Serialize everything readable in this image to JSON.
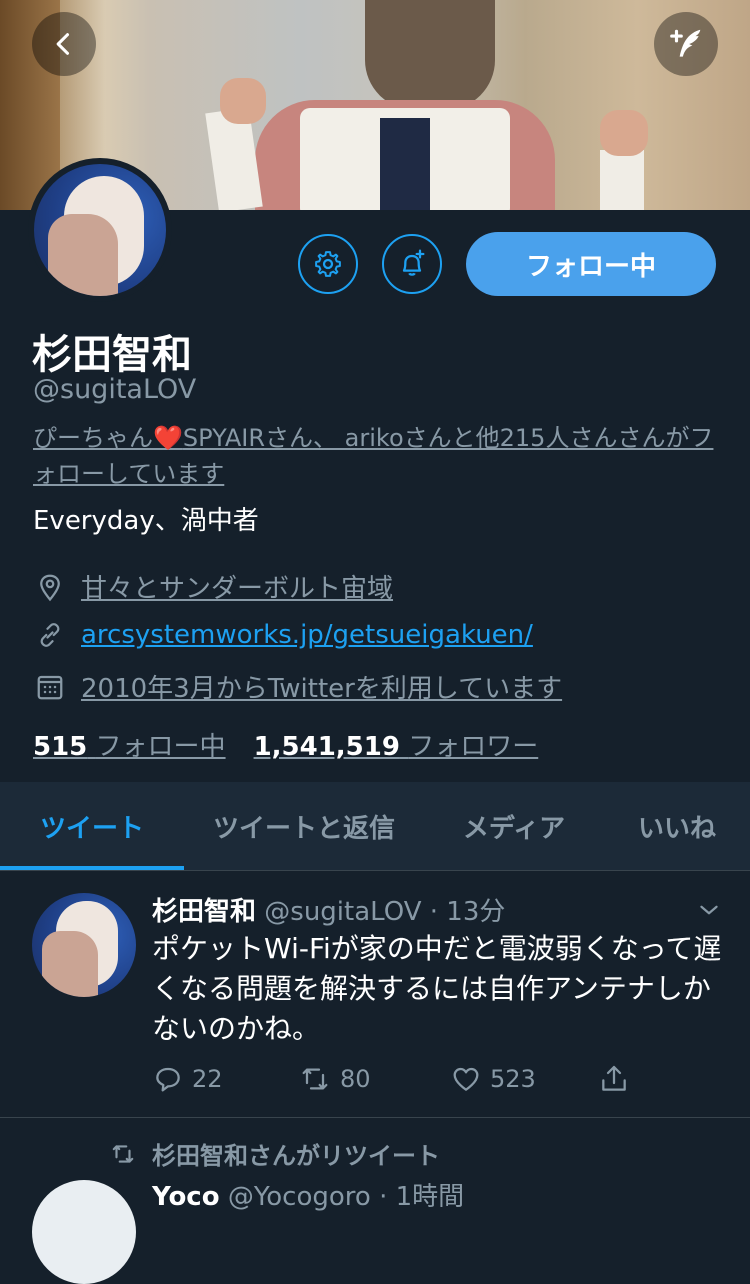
{
  "header": {
    "back_icon": "chevron-left-icon",
    "compose_icon": "compose-tweet-icon"
  },
  "profile": {
    "name": "杉田智和",
    "handle": "@sugitaLOV",
    "followed_by_prefix": "ぴーちゃん",
    "followed_by_rest": "SPYAIRさん、 arikoさんと他215人さんさんがフォローしています",
    "bio": "Everyday、渦中者",
    "location": "甘々とサンダーボルト宙域",
    "website": "arcsystemworks.jp/getsueigakuen/",
    "joined": "2010年3月からTwitterを利用しています",
    "following_count": "515",
    "following_label": "フォロー中",
    "followers_count": "1,541,519",
    "followers_label": "フォロワー"
  },
  "buttons": {
    "settings_icon": "gear-icon",
    "notify_icon": "bell-plus-icon",
    "follow_label": "フォロー中"
  },
  "tabs": [
    {
      "label": "ツイート",
      "active": true
    },
    {
      "label": "ツイートと返信",
      "active": false
    },
    {
      "label": "メディア",
      "active": false
    },
    {
      "label": "いいね",
      "active": false
    }
  ],
  "tweet": {
    "name": "杉田智和",
    "handle_time": "@sugitaLOV · 13分",
    "text": "ポケットWi-Fiが家の中だと電波弱くなって遅くなる問題を解決するには自作アンテナしかないのかね。",
    "replies": "22",
    "retweets": "80",
    "likes": "523"
  },
  "retweet_notice": "杉田智和さんがリツイート",
  "next_tweet": {
    "name": "Yoco",
    "handle_time": "@Yocogoro · 1時間"
  },
  "colors": {
    "background": "#15202b",
    "accent": "#1da1f2",
    "muted": "#8899a6",
    "heart": "#e0245e"
  }
}
